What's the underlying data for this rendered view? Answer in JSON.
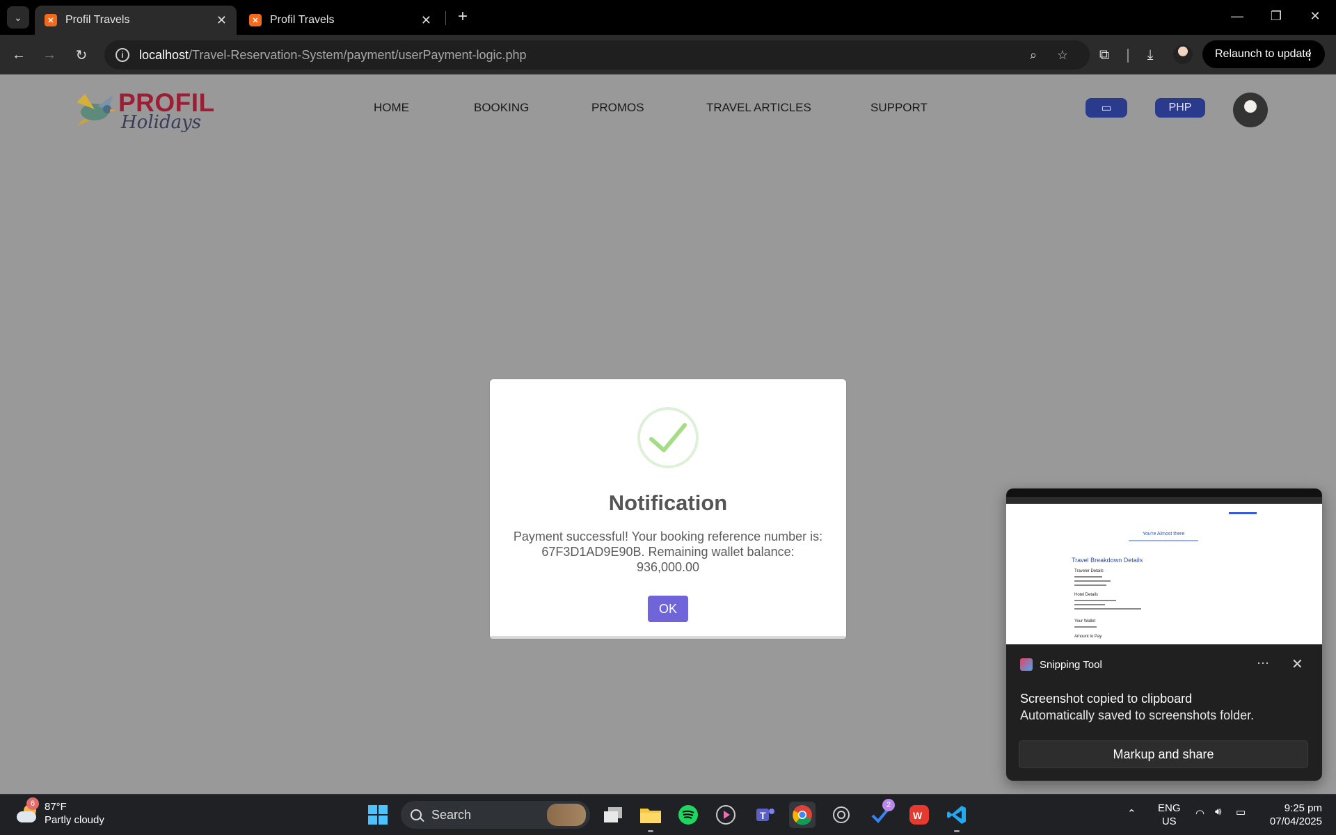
{
  "browser": {
    "tabs": [
      {
        "title": "Profil Travels",
        "active": true
      },
      {
        "title": "Profil Travels",
        "active": false
      }
    ],
    "url_host": "localhost",
    "url_path": "/Travel-Reservation-System/payment/userPayment-logic.php",
    "relaunch_label": "Relaunch to update"
  },
  "site": {
    "logo_word1": "PROFIL",
    "logo_word2": "Holidays",
    "nav": [
      "HOME",
      "BOOKING",
      "PROMOS",
      "TRAVEL ARTICLES",
      "SUPPORT"
    ],
    "currency_label": "PHP"
  },
  "modal": {
    "title": "Notification",
    "message": "Payment successful! Your booking reference number is: 67F3D1AD9E90B. Remaining wallet balance: 936,000.00",
    "ok_label": "OK"
  },
  "toast": {
    "app_name": "Snipping Tool",
    "line1": "Screenshot copied to clipboard",
    "line2": "Automatically saved to screenshots folder.",
    "action_label": "Markup and share",
    "thumb_heading1": "You're Almost there",
    "thumb_heading2": "Travel Breakdown Details",
    "thumb_sections": [
      "Traveler Details",
      "Hotel Details",
      "Your Wallet",
      "Amount to Pay"
    ]
  },
  "taskbar": {
    "weather_temp": "87°F",
    "weather_desc": "Partly cloudy",
    "weather_badge": "6",
    "search_label": "Search",
    "todo_badge": "2",
    "lang_line1": "ENG",
    "lang_line2": "US",
    "time": "9:25 pm",
    "date": "07/04/2025"
  },
  "colors": {
    "page_overlay": "#999999",
    "ok_button": "#7064d9",
    "pill": "#2a3a8c",
    "success_check": "#a5dc86"
  }
}
